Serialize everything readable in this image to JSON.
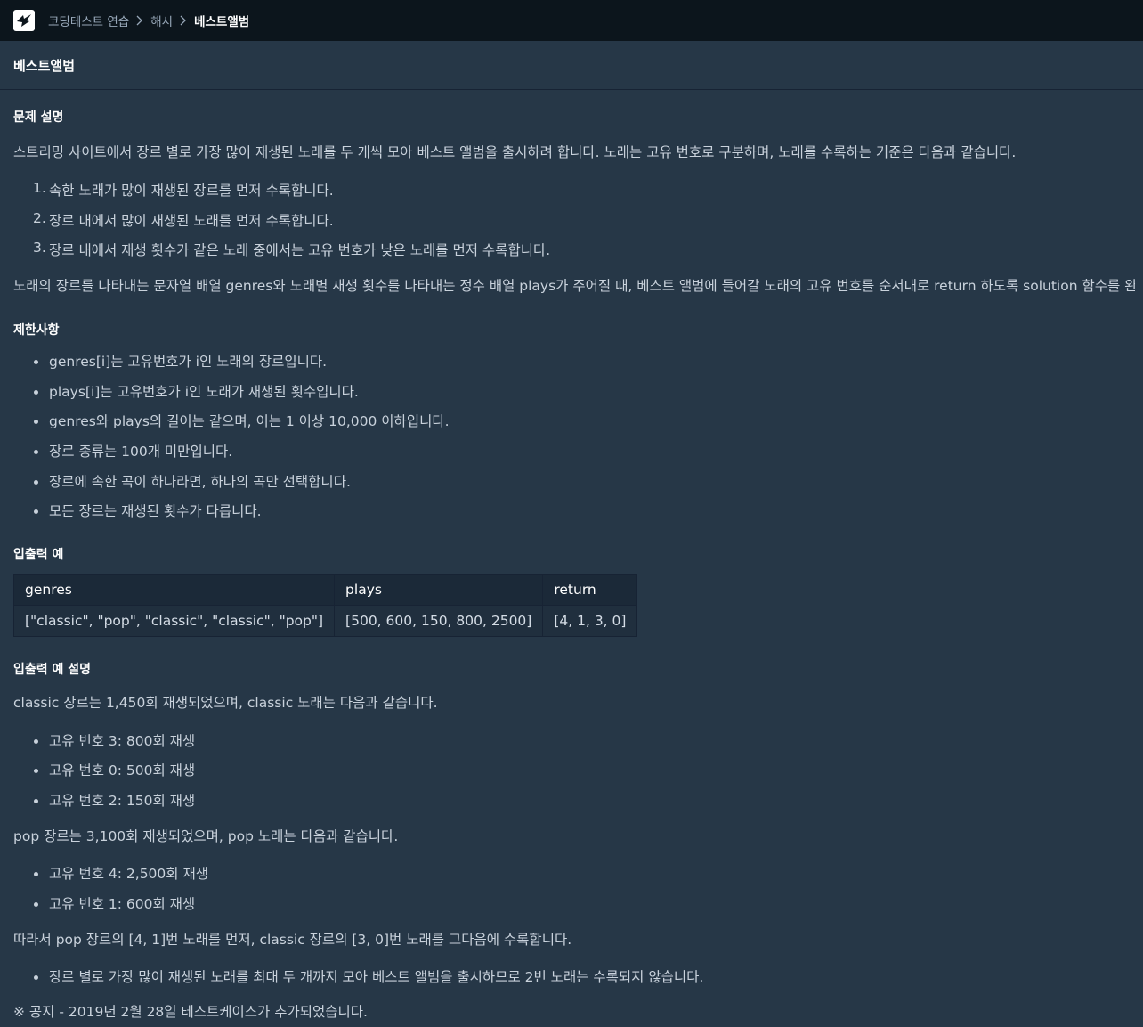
{
  "breadcrumb": {
    "items": [
      "코딩테스트 연습",
      "해시",
      "베스트앨범"
    ]
  },
  "page_title": "베스트앨범",
  "sections": {
    "problem_heading": "문제 설명",
    "intro": "스트리밍 사이트에서 장르 별로 가장 많이 재생된 노래를 두 개씩 모아 베스트 앨범을 출시하려 합니다. 노래는 고유 번호로 구분하며, 노래를 수록하는 기준은 다음과 같습니다.",
    "rules": [
      "속한 노래가 많이 재생된 장르를 먼저 수록합니다.",
      "장르 내에서 많이 재생된 노래를 먼저 수록합니다.",
      "장르 내에서 재생 횟수가 같은 노래 중에서는 고유 번호가 낮은 노래를 먼저 수록합니다."
    ],
    "task": "노래의 장르를 나타내는 문자열 배열 genres와 노래별 재생 횟수를 나타내는 정수 배열 plays가 주어질 때, 베스트 앨범에 들어갈 노래의 고유 번호를 순서대로 return 하도록 solution 함수를 완성하세요.",
    "constraints_heading": "제한사항",
    "constraints": [
      "genres[i]는 고유번호가 i인 노래의 장르입니다.",
      "plays[i]는 고유번호가 i인 노래가 재생된 횟수입니다.",
      "genres와 plays의 길이는 같으며, 이는 1 이상 10,000 이하입니다.",
      "장르 종류는 100개 미만입니다.",
      "장르에 속한 곡이 하나라면, 하나의 곡만 선택합니다.",
      "모든 장르는 재생된 횟수가 다릅니다."
    ],
    "io_heading": "입출력 예",
    "io_table": {
      "headers": [
        "genres",
        "plays",
        "return"
      ],
      "rows": [
        [
          "[\"classic\", \"pop\", \"classic\", \"classic\", \"pop\"]",
          "[500, 600, 150, 800, 2500]",
          "[4, 1, 3, 0]"
        ]
      ]
    },
    "io_explain_heading": "입출력 예 설명",
    "classic_text": "classic 장르는 1,450회 재생되었으며, classic 노래는 다음과 같습니다.",
    "classic_items": [
      "고유 번호 3: 800회 재생",
      "고유 번호 0: 500회 재생",
      "고유 번호 2: 150회 재생"
    ],
    "pop_text": "pop 장르는 3,100회 재생되었으며, pop 노래는 다음과 같습니다.",
    "pop_items": [
      "고유 번호 4: 2,500회 재생",
      "고유 번호 1: 600회 재생"
    ],
    "conclusion": "따라서 pop 장르의 [4, 1]번 노래를 먼저, classic 장르의 [3, 0]번 노래를 그다음에 수록합니다.",
    "conclusion_items": [
      "장르 별로 가장 많이 재생된 노래를 최대 두 개까지 모아 베스트 앨범을 출시하므로 2번 노래는 수록되지 않습니다."
    ],
    "notice": "※ 공지 - 2019년 2월 28일 테스트케이스가 추가되었습니다."
  },
  "colors": {
    "topbar_bg": "#0c151c",
    "page_bg": "#263747",
    "table_header_bg": "#1b2938",
    "table_cell_bg": "#202f3e"
  }
}
